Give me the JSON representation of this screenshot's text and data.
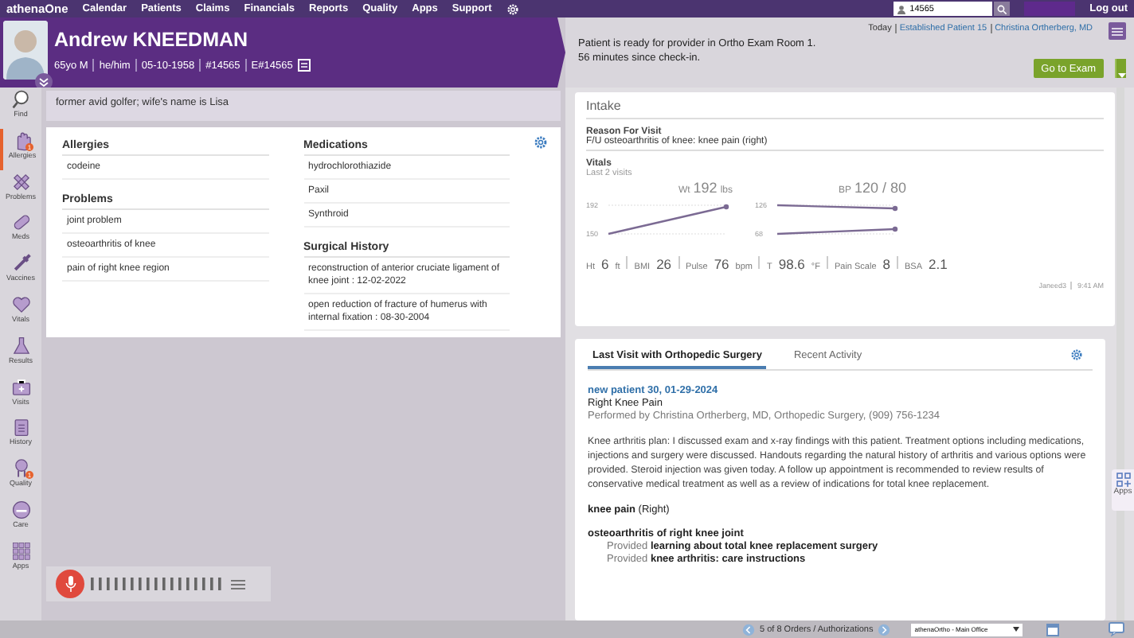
{
  "nav": {
    "logo": "athenaOne",
    "items": [
      "Calendar",
      "Patients",
      "Claims",
      "Financials",
      "Reports",
      "Quality",
      "Apps",
      "Support"
    ],
    "search": {
      "value": "14565"
    },
    "logout": "Log out"
  },
  "patient": {
    "name": "Andrew KNEEDMAN",
    "details": [
      "65yo M",
      "he/him",
      "05-10-1958",
      "#14565",
      "E#14565"
    ]
  },
  "status": {
    "breadcrumb": [
      "Today",
      "Established Patient 15",
      "Christina Ortherberg, MD"
    ],
    "message": [
      "Patient is ready for provider in Ortho Exam Room 1.",
      "56 minutes since check-in."
    ],
    "button": "Go to Exam"
  },
  "sidebar": {
    "items": [
      {
        "label": "Find",
        "selected": false
      },
      {
        "label": "Allergies",
        "selected": true,
        "badge": "1"
      },
      {
        "label": "Problems",
        "selected": false
      },
      {
        "label": "Meds",
        "selected": false
      },
      {
        "label": "Vaccines",
        "selected": false
      },
      {
        "label": "Vitals",
        "selected": false
      },
      {
        "label": "Results",
        "selected": false
      },
      {
        "label": "Visits",
        "selected": false
      },
      {
        "label": "History",
        "selected": false
      },
      {
        "label": "Quality",
        "selected": false,
        "badge": "1"
      },
      {
        "label": "Care",
        "selected": false
      },
      {
        "label": "Apps",
        "selected": false
      }
    ]
  },
  "note": "former avid golfer; wife's name is Lisa",
  "summary": {
    "columns": [
      [
        {
          "title": "Allergies",
          "items": [
            "codeine"
          ]
        },
        {
          "title": "Problems",
          "items": [
            "joint problem",
            "osteoarthritis of knee",
            "pain of right knee region"
          ]
        }
      ],
      [
        {
          "title": "Medications",
          "items": [
            "hydrochlorothiazide",
            "Paxil",
            "Synthroid"
          ]
        },
        {
          "title": "Surgical History",
          "items": [
            "reconstruction of anterior cruciate ligament of knee joint : 12-02-2022",
            "open reduction of fracture of humerus with internal fixation : 08-30-2004"
          ]
        }
      ]
    ]
  },
  "intake": {
    "title": "Intake",
    "reason_label": "Reason For Visit",
    "reason": "F/U osteoarthritis of knee: knee pain (right)",
    "vitals_label": "Vitals",
    "vitals_sub": "Last 2 visits",
    "charts": [
      {
        "label": "Wt",
        "value": "192",
        "unit": "lbs",
        "kind": "rising",
        "ticks": [
          "192",
          "150"
        ]
      },
      {
        "label": "BP",
        "value": "120 / 80",
        "kind": "pair",
        "ticks": [
          "126",
          "68"
        ]
      }
    ],
    "stats": [
      {
        "label": "Ht",
        "value": "6",
        "unit": "ft"
      },
      {
        "label": "BMI",
        "value": "26"
      },
      {
        "label": "Pulse",
        "value": "76",
        "unit": "bpm"
      },
      {
        "label": "T",
        "value": "98.6",
        "unit": "°F"
      },
      {
        "label": "Pain Scale",
        "value": "8"
      },
      {
        "label": "BSA",
        "value": "2.1"
      }
    ],
    "footer": [
      "Janeed3",
      "9:41 AM"
    ]
  },
  "last_visit": {
    "tabs": [
      {
        "label": "Last Visit with Orthopedic Surgery",
        "selected": true
      },
      {
        "label": "Recent Activity",
        "selected": false
      }
    ],
    "visit_link": "new patient 30, 01-29-2024",
    "visit_title": "Right Knee Pain",
    "performed_by": "Performed by Christina Ortherberg, MD, Orthopedic Surgery, (909) 756-1234",
    "plan": "Knee arthritis plan: I discussed exam and x-ray findings with this patient. Treatment options including medications, injections and surgery were discussed. Handouts regarding the natural history of arthritis and various options were provided. Steroid injection was given today. A follow up appointment is recommended to review results of conservative medical treatment as well as a review of indications for total knee replacement.",
    "diagnoses": [
      {
        "title": "**knee pain** (Right)"
      },
      {
        "title": "**osteoarthritis of right knee joint**",
        "items": [
          "Provided **learning about total knee replacement surgery**",
          "Provided **knee arthritis: care instructions**"
        ]
      }
    ]
  },
  "apps_tab": "Apps",
  "status_bar": {
    "orders": "5 of 8 Orders / Authorizations",
    "department": "athenaOrtho - Main Office"
  }
}
